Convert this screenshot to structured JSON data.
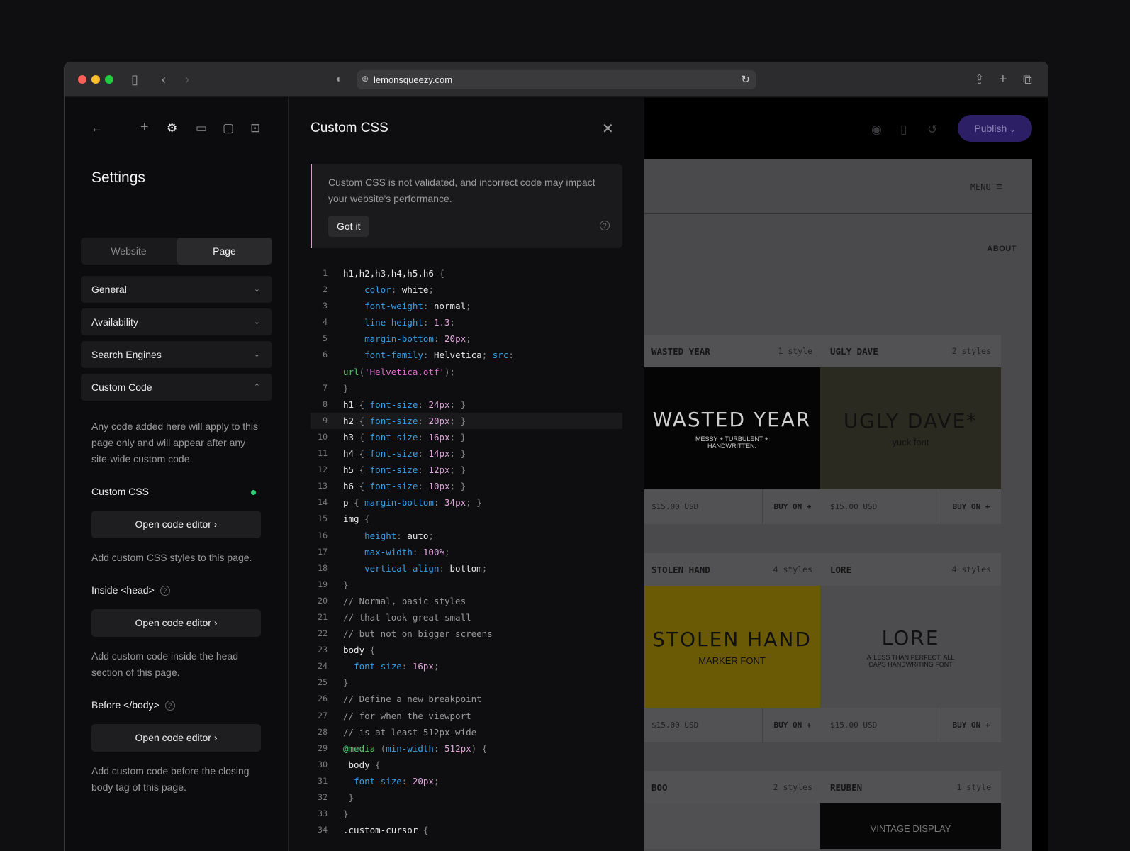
{
  "browser": {
    "url": "lemonsqueezy.com"
  },
  "sidebar": {
    "title": "Settings",
    "tabs": [
      "Website",
      "Page"
    ],
    "active_tab": "Page",
    "sections": [
      {
        "label": "General",
        "expanded": false
      },
      {
        "label": "Availability",
        "expanded": false
      },
      {
        "label": "Search Engines",
        "expanded": false
      },
      {
        "label": "Custom Code",
        "expanded": true
      }
    ],
    "custom_code_intro": "Any code added here will apply to this page only and will appear after any site-wide custom code.",
    "custom_css": {
      "label": "Custom CSS",
      "button": "Open code editor",
      "help": "Add custom CSS styles to this page.",
      "status_color": "#2fd27a"
    },
    "head": {
      "label": "Inside <head>",
      "button": "Open code editor",
      "help": "Add custom code inside the head section of this page."
    },
    "body": {
      "label": "Before </body>",
      "button": "Open code editor",
      "help": "Add custom code before the closing body tag of this page."
    }
  },
  "editor": {
    "title": "Custom CSS",
    "warning": "Custom CSS is not validated, and incorrect code may impact your website's performance.",
    "got_it": "Got it",
    "highlighted_line": 9,
    "lines": [
      {
        "n": "1",
        "t": [
          [
            "sel",
            "h1,h2,h3,h4,h5,h6 "
          ],
          [
            "p",
            "{"
          ]
        ]
      },
      {
        "n": "2",
        "t": [
          [
            "sel",
            "    "
          ],
          [
            "prop",
            "color"
          ],
          [
            "p",
            ": "
          ],
          [
            "val",
            "white"
          ],
          [
            "p",
            ";"
          ]
        ]
      },
      {
        "n": "3",
        "t": [
          [
            "sel",
            "    "
          ],
          [
            "prop",
            "font-weight"
          ],
          [
            "p",
            ": "
          ],
          [
            "val",
            "normal"
          ],
          [
            "p",
            ";"
          ]
        ]
      },
      {
        "n": "4",
        "t": [
          [
            "sel",
            "    "
          ],
          [
            "prop",
            "line-height"
          ],
          [
            "p",
            ": "
          ],
          [
            "num",
            "1.3"
          ],
          [
            "p",
            ";"
          ]
        ]
      },
      {
        "n": "5",
        "t": [
          [
            "sel",
            "    "
          ],
          [
            "prop",
            "margin-bottom"
          ],
          [
            "p",
            ": "
          ],
          [
            "num",
            "20px"
          ],
          [
            "p",
            ";"
          ]
        ]
      },
      {
        "n": "6",
        "t": [
          [
            "sel",
            "    "
          ],
          [
            "prop",
            "font-family"
          ],
          [
            "p",
            ": "
          ],
          [
            "val",
            "Helvetica"
          ],
          [
            "p",
            "; "
          ],
          [
            "prop",
            "src"
          ],
          [
            "p",
            ":"
          ]
        ]
      },
      {
        "n": "",
        "t": [
          [
            "fn",
            "url"
          ],
          [
            "p",
            "("
          ],
          [
            "str",
            "'Helvetica.otf'"
          ],
          [
            "p",
            ");"
          ]
        ]
      },
      {
        "n": "7",
        "t": [
          [
            "p",
            "}"
          ]
        ]
      },
      {
        "n": "8",
        "t": [
          [
            "sel",
            "h1 "
          ],
          [
            "p",
            "{ "
          ],
          [
            "prop",
            "font-size"
          ],
          [
            "p",
            ": "
          ],
          [
            "num",
            "24px"
          ],
          [
            "p",
            "; }"
          ]
        ]
      },
      {
        "n": "9",
        "t": [
          [
            "sel",
            "h2 "
          ],
          [
            "p",
            "{ "
          ],
          [
            "prop",
            "font-size"
          ],
          [
            "p",
            ": "
          ],
          [
            "num",
            "20px"
          ],
          [
            "p",
            "; }"
          ]
        ]
      },
      {
        "n": "10",
        "t": [
          [
            "sel",
            "h3 "
          ],
          [
            "p",
            "{ "
          ],
          [
            "prop",
            "font-size"
          ],
          [
            "p",
            ": "
          ],
          [
            "num",
            "16px"
          ],
          [
            "p",
            "; }"
          ]
        ]
      },
      {
        "n": "11",
        "t": [
          [
            "sel",
            "h4 "
          ],
          [
            "p",
            "{ "
          ],
          [
            "prop",
            "font-size"
          ],
          [
            "p",
            ": "
          ],
          [
            "num",
            "14px"
          ],
          [
            "p",
            "; }"
          ]
        ]
      },
      {
        "n": "12",
        "t": [
          [
            "sel",
            "h5 "
          ],
          [
            "p",
            "{ "
          ],
          [
            "prop",
            "font-size"
          ],
          [
            "p",
            ": "
          ],
          [
            "num",
            "12px"
          ],
          [
            "p",
            "; }"
          ]
        ]
      },
      {
        "n": "13",
        "t": [
          [
            "sel",
            "h6 "
          ],
          [
            "p",
            "{ "
          ],
          [
            "prop",
            "font-size"
          ],
          [
            "p",
            ": "
          ],
          [
            "num",
            "10px"
          ],
          [
            "p",
            "; }"
          ]
        ]
      },
      {
        "n": "14",
        "t": [
          [
            "sel",
            "p "
          ],
          [
            "p",
            "{ "
          ],
          [
            "prop",
            "margin-bottom"
          ],
          [
            "p",
            ": "
          ],
          [
            "num",
            "34px"
          ],
          [
            "p",
            "; }"
          ]
        ]
      },
      {
        "n": "15",
        "t": [
          [
            "sel",
            "img "
          ],
          [
            "p",
            "{"
          ]
        ]
      },
      {
        "n": "16",
        "t": [
          [
            "sel",
            "    "
          ],
          [
            "prop",
            "height"
          ],
          [
            "p",
            ": "
          ],
          [
            "val",
            "auto"
          ],
          [
            "p",
            ";"
          ]
        ]
      },
      {
        "n": "17",
        "t": [
          [
            "sel",
            "    "
          ],
          [
            "prop",
            "max-width"
          ],
          [
            "p",
            ": "
          ],
          [
            "num",
            "100%"
          ],
          [
            "p",
            ";"
          ]
        ]
      },
      {
        "n": "18",
        "t": [
          [
            "sel",
            "    "
          ],
          [
            "prop",
            "vertical-align"
          ],
          [
            "p",
            ": "
          ],
          [
            "val",
            "bottom"
          ],
          [
            "p",
            ";"
          ]
        ]
      },
      {
        "n": "19",
        "t": [
          [
            "p",
            "}"
          ]
        ]
      },
      {
        "n": "20",
        "t": [
          [
            "com",
            "// Normal, basic styles"
          ]
        ]
      },
      {
        "n": "21",
        "t": [
          [
            "com",
            "// that look great small"
          ]
        ]
      },
      {
        "n": "22",
        "t": [
          [
            "com",
            "// but not on bigger screens"
          ]
        ]
      },
      {
        "n": "23",
        "t": [
          [
            "sel",
            "body "
          ],
          [
            "p",
            "{"
          ]
        ]
      },
      {
        "n": "24",
        "t": [
          [
            "sel",
            "  "
          ],
          [
            "prop",
            "font-size"
          ],
          [
            "p",
            ": "
          ],
          [
            "num",
            "16px"
          ],
          [
            "p",
            ";"
          ]
        ]
      },
      {
        "n": "25",
        "t": [
          [
            "p",
            "}"
          ]
        ]
      },
      {
        "n": "26",
        "t": [
          [
            "com",
            "// Define a new breakpoint"
          ]
        ]
      },
      {
        "n": "27",
        "t": [
          [
            "com",
            "// for when the viewport"
          ]
        ]
      },
      {
        "n": "28",
        "t": [
          [
            "com",
            "// is at least 512px wide"
          ]
        ]
      },
      {
        "n": "29",
        "t": [
          [
            "fn",
            "@media "
          ],
          [
            "p",
            "("
          ],
          [
            "prop",
            "min-width"
          ],
          [
            "p",
            ": "
          ],
          [
            "num",
            "512px"
          ],
          [
            "p",
            ") {"
          ]
        ]
      },
      {
        "n": "30",
        "t": [
          [
            "sel",
            " body "
          ],
          [
            "p",
            "{"
          ]
        ]
      },
      {
        "n": "31",
        "t": [
          [
            "sel",
            "  "
          ],
          [
            "prop",
            "font-size"
          ],
          [
            "p",
            ": "
          ],
          [
            "num",
            "20px"
          ],
          [
            "p",
            ";"
          ]
        ]
      },
      {
        "n": "32",
        "t": [
          [
            "p",
            " }"
          ]
        ]
      },
      {
        "n": "33",
        "t": [
          [
            "p",
            "}"
          ]
        ]
      },
      {
        "n": "34",
        "t": [
          [
            "sel",
            ".custom-cursor "
          ],
          [
            "p",
            "{"
          ]
        ]
      }
    ]
  },
  "preview": {
    "publish": "Publish",
    "accent": "#2d1f66",
    "menu": "MENU",
    "about": "ABOUT",
    "cards": [
      {
        "name": "WASTED YEAR",
        "styles": "1 style",
        "price": "$15.00 USD",
        "buy": "BUY ON +",
        "art": "WASTED YEAR",
        "art_sub": "MESSY + TURBULENT + HANDWRITTEN.",
        "bg": "#050505",
        "fg": "#cfcfcf"
      },
      {
        "name": "UGLY DAVE",
        "styles": "2 styles",
        "price": "$15.00 USD",
        "buy": "BUY ON +",
        "art": "UGLY DAVE*",
        "art_sub": "yuck font",
        "bg": "#2a2a20",
        "fg": "#111"
      },
      {
        "name": "STOLEN HAND",
        "styles": "4 styles",
        "price": "$15.00 USD",
        "buy": "BUY ON +",
        "art": "STOLEN HAND",
        "art_sub": "MARKER FONT",
        "bg": "#6b5a05",
        "fg": "#111"
      },
      {
        "name": "LORE",
        "styles": "4 styles",
        "price": "$15.00 USD",
        "buy": "BUY ON +",
        "art": "LORE",
        "art_sub": "A 'LESS THAN PERFECT' ALL CAPS HANDWRITING FONT",
        "bg": "#4d4d4f",
        "fg": "#111"
      },
      {
        "name": "BOO",
        "styles": "2 styles",
        "price": "",
        "buy": "",
        "art": "",
        "art_sub": "",
        "bg": "#505052",
        "fg": "#111"
      },
      {
        "name": "REUBEN",
        "styles": "1 style",
        "price": "",
        "buy": "",
        "art": "",
        "art_sub": "VINTAGE  DISPLAY",
        "bg": "#070707",
        "fg": "#777"
      }
    ]
  }
}
